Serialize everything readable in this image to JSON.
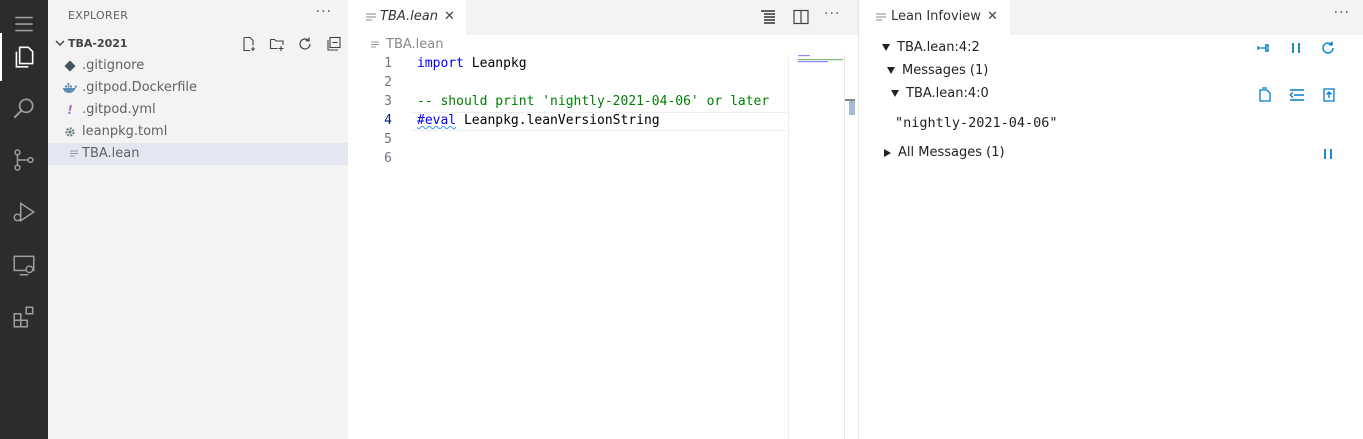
{
  "activity_bar": {
    "items": [
      {
        "name": "menu-icon"
      },
      {
        "name": "explorer-icon",
        "active": true
      },
      {
        "name": "search-icon"
      },
      {
        "name": "source-control-icon"
      },
      {
        "name": "run-debug-icon"
      },
      {
        "name": "remote-explorer-icon"
      },
      {
        "name": "extensions-icon"
      }
    ]
  },
  "sidebar": {
    "title": "EXPLORER",
    "more": "···",
    "folder": "TBA-2021",
    "files": [
      {
        "label": ".gitignore",
        "icon": "gitignore-icon"
      },
      {
        "label": ".gitpod.Dockerfile",
        "icon": "docker-icon"
      },
      {
        "label": ".gitpod.yml",
        "icon": "yaml-icon"
      },
      {
        "label": "leanpkg.toml",
        "icon": "gear-icon"
      },
      {
        "label": "TBA.lean",
        "icon": "text-file-icon",
        "selected": true
      }
    ]
  },
  "editor": {
    "tab_label": "TBA.lean",
    "breadcrumb": "TBA.lean",
    "more": "···",
    "line_numbers": [
      "1",
      "2",
      "3",
      "4",
      "5",
      "6"
    ],
    "current_line": "4",
    "code": {
      "line1_kw": "import",
      "line1_rest": " Leanpkg",
      "line3_comment": "-- should print 'nightly-2021-04-06' or later",
      "line4_kw": "#eval",
      "line4_rest": " Leanpkg.leanVersionString"
    }
  },
  "infoview": {
    "tab_label": "Lean Infoview",
    "more": "···",
    "goal_header": "TBA.lean:4:2",
    "messages_header": "Messages (1)",
    "message_location": "TBA.lean:4:0",
    "message_text": "\"nightly-2021-04-06\"",
    "all_messages": "All Messages (1)"
  },
  "colors": {
    "activity_bg": "#2c2c2c",
    "sidebar_bg": "#f3f3f3",
    "selection_bg": "#e4e6f1",
    "keyword": "#0000ff",
    "comment": "#008000",
    "icon_blue": "#007acc"
  }
}
